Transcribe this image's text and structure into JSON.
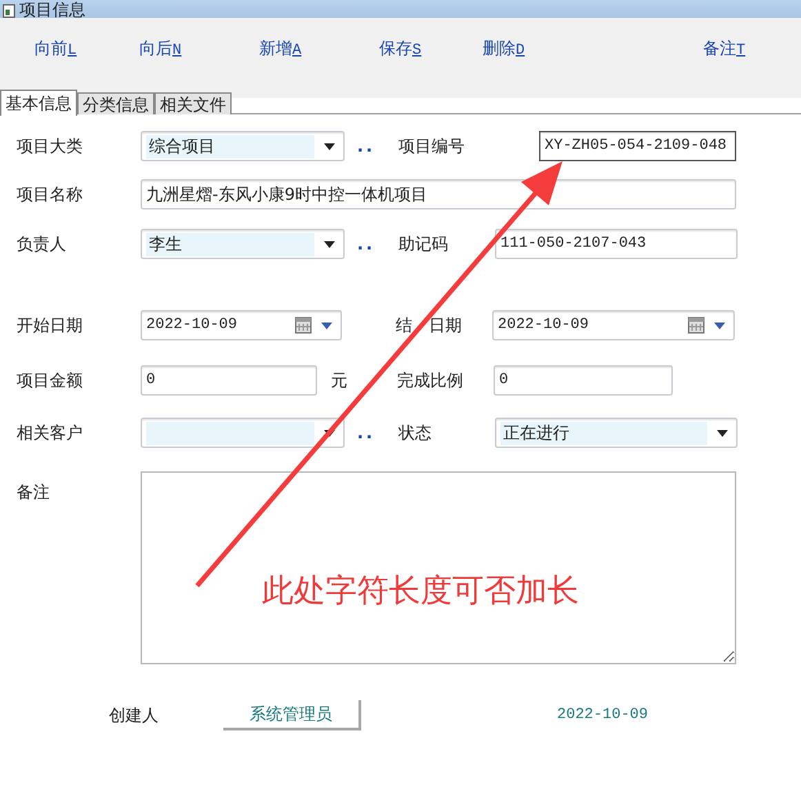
{
  "window": {
    "title": "项目信息"
  },
  "toolbar": [
    {
      "label": "向前",
      "key": "L"
    },
    {
      "label": "向后",
      "key": "N"
    },
    {
      "label": "新增",
      "key": "A"
    },
    {
      "label": "保存",
      "key": "S"
    },
    {
      "label": "删除",
      "key": "D"
    },
    {
      "label": "备注",
      "key": "T"
    }
  ],
  "tabs": [
    {
      "label": "基本信息",
      "selected": true
    },
    {
      "label": "分类信息",
      "selected": false
    },
    {
      "label": "相关文件",
      "selected": false
    }
  ],
  "rows": [
    [
      {
        "label": "项目大类",
        "kind": "combo",
        "value": "综合项目",
        "lookup": ".."
      },
      {
        "label": "项目编号",
        "kind": "code",
        "value": "XY-ZH05-054-2109-048"
      }
    ],
    [
      {
        "label": "项目名称",
        "kind": "wide",
        "value": "九洲星熠-东风小康9时中控一体机项目"
      }
    ],
    [
      {
        "label": "负责人",
        "kind": "combo",
        "value": "李生",
        "lookup": ".."
      },
      {
        "label": "助记码",
        "kind": "text",
        "value": "111-050-2107-043"
      }
    ],
    [
      {
        "label": "开始日期",
        "kind": "date",
        "value": "2022-10-09"
      },
      {
        "label": "结",
        "label_after": "日期",
        "kind": "date",
        "value": "2022-10-09"
      }
    ],
    [
      {
        "label": "项目金额",
        "kind": "text",
        "value": "0",
        "unit": "元"
      },
      {
        "label": "完成比例",
        "kind": "short",
        "value": "0"
      }
    ],
    [
      {
        "label": "相关客户",
        "kind": "combo",
        "lookup": ".."
      },
      {
        "label": "状态",
        "kind": "combo",
        "value": "正在进行"
      }
    ]
  ],
  "notes": {
    "label": "备注"
  },
  "footer": {
    "creator_label": "创建人",
    "creator": "系统管理员",
    "created_date": "2022-10-09"
  },
  "annotation": {
    "text": "此处字符长度可否加长"
  }
}
